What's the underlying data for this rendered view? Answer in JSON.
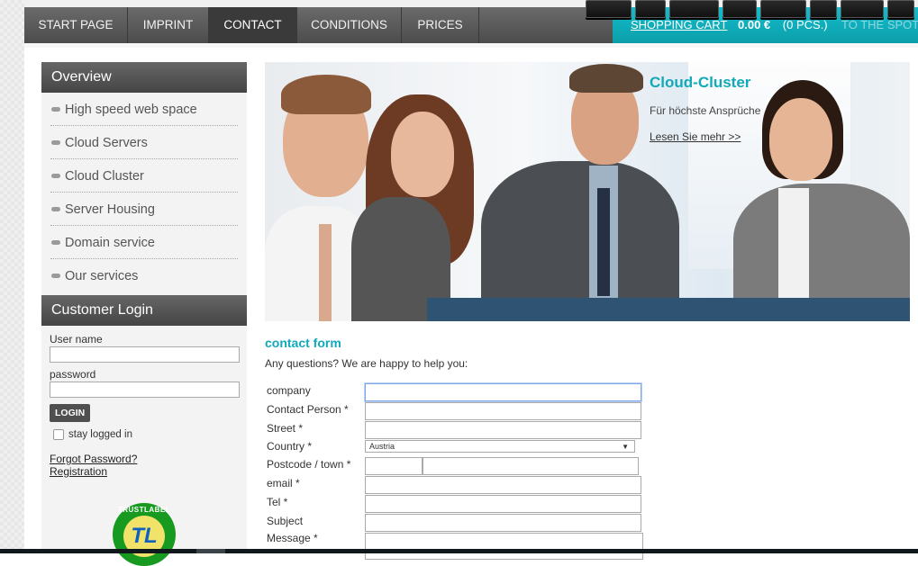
{
  "nav": {
    "items": [
      {
        "label": "START PAGE",
        "active": false
      },
      {
        "label": "IMPRINT",
        "active": false
      },
      {
        "label": "CONTACT",
        "active": true
      },
      {
        "label": "CONDITIONS",
        "active": false
      },
      {
        "label": "PRICES",
        "active": false
      }
    ]
  },
  "cart": {
    "link_label": "SHOPPING CART",
    "total": "0.00 €",
    "count": "(0 PCS.)",
    "spot_label": "TO THE SPOT"
  },
  "sidebar": {
    "overview_title": "Overview",
    "menu": [
      {
        "label": "High speed web space"
      },
      {
        "label": "Cloud Servers"
      },
      {
        "label": "Cloud Cluster"
      },
      {
        "label": "Server Housing"
      },
      {
        "label": "Domain service"
      },
      {
        "label": "Our services"
      }
    ],
    "login": {
      "title": "Customer Login",
      "username_label": "User name",
      "username_value": "",
      "password_label": "password",
      "password_value": "",
      "button_label": "LOGIN",
      "stay_logged_in_label": "stay logged in",
      "stay_logged_in_checked": false,
      "forgot_label": "Forgot Password? ",
      "registration_label": "Registration"
    },
    "trustlabel": {
      "ring_text": "TRUSTLABEL",
      "monogram": "TL"
    }
  },
  "banner": {
    "title": "Cloud-Cluster",
    "subtitle": "Für höchste Ansprüche",
    "link_label": "Lesen Sie mehr >>"
  },
  "contact_form": {
    "title": "contact form",
    "intro": "Any questions? We are happy to help you:",
    "fields": {
      "company": {
        "label": "company",
        "value": ""
      },
      "contact_person": {
        "label": "Contact Person *",
        "value": ""
      },
      "street": {
        "label": "Street *",
        "value": ""
      },
      "country": {
        "label": "Country *",
        "value": "Austria"
      },
      "postcode_town": {
        "label": "Postcode / town *",
        "postcode": "",
        "town": ""
      },
      "email": {
        "label": "email *",
        "value": ""
      },
      "tel": {
        "label": "Tel *",
        "value": ""
      },
      "subject": {
        "label": "Subject",
        "value": ""
      },
      "message": {
        "label": "Message *",
        "value": ""
      }
    }
  },
  "colors": {
    "accent": "#12a9b8",
    "nav_bg": "#555555",
    "nav_active": "#3a3a3a",
    "cart_bg": "#0fb0bd"
  }
}
